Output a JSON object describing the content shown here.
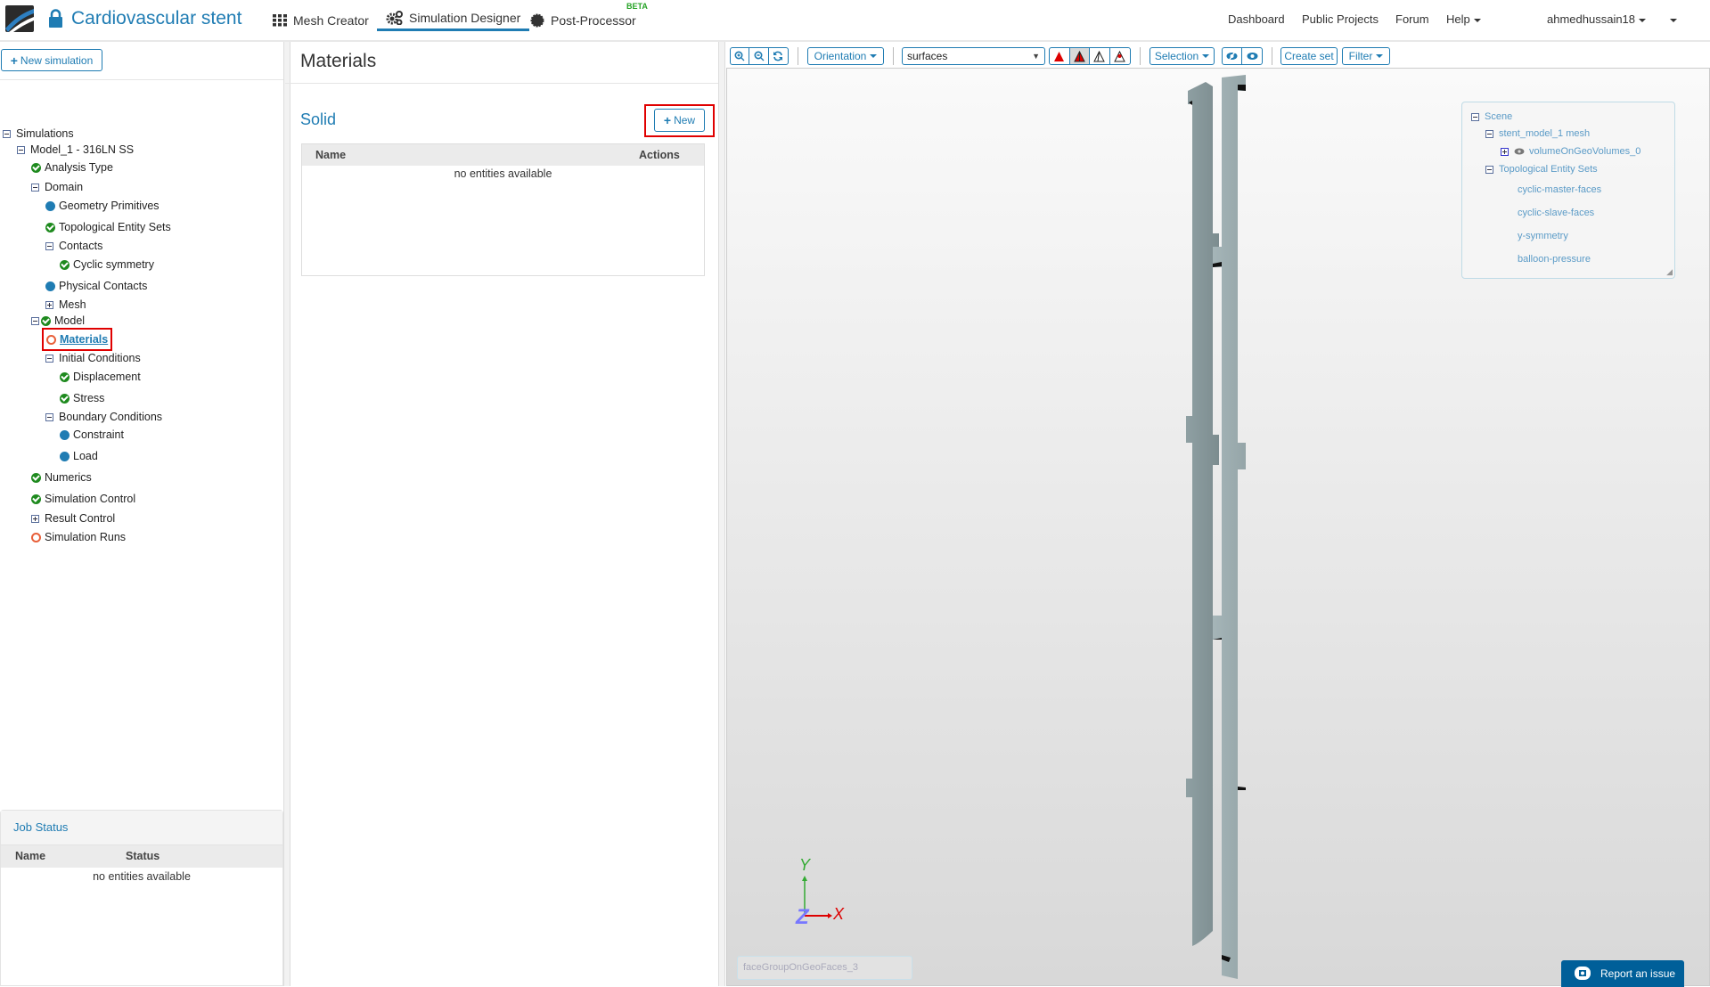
{
  "header": {
    "project_title": "Cardiovascular stent",
    "tabs": [
      {
        "label": "Mesh Creator",
        "icon": "grid-icon"
      },
      {
        "label": "Simulation Designer",
        "icon": "gears-icon",
        "active": true
      },
      {
        "label": "Post-Processor",
        "icon": "gear-icon",
        "badge": "BETA"
      }
    ],
    "right_nav": [
      "Dashboard",
      "Public Projects",
      "Forum",
      "Help"
    ],
    "user": "ahmedhussain18"
  },
  "sidebar": {
    "new_simulation_label": "New simulation",
    "tree": [
      {
        "label": "Simulations",
        "level": 0,
        "icon": "collapse"
      },
      {
        "label": "Model_1 - 316LN SS",
        "level": 1,
        "icon": "collapse"
      },
      {
        "label": "Analysis Type",
        "level": 2,
        "icon": "ok"
      },
      {
        "label": "Domain",
        "level": 2,
        "icon": "collapse"
      },
      {
        "label": "Geometry Primitives",
        "level": 3,
        "icon": "dot"
      },
      {
        "label": "Topological Entity Sets",
        "level": 3,
        "icon": "ok"
      },
      {
        "label": "Contacts",
        "level": 3,
        "icon": "collapse"
      },
      {
        "label": "Cyclic symmetry",
        "level": 4,
        "icon": "ok"
      },
      {
        "label": "Physical Contacts",
        "level": 3,
        "icon": "dot"
      },
      {
        "label": "Mesh",
        "level": 3,
        "icon": "expand"
      },
      {
        "label": "Model",
        "level": 2,
        "icon": "collapse-ok"
      },
      {
        "label": "Materials",
        "level": 3,
        "icon": "ring",
        "selected": true
      },
      {
        "label": "Initial Conditions",
        "level": 3,
        "icon": "collapse"
      },
      {
        "label": "Displacement",
        "level": 4,
        "icon": "ok"
      },
      {
        "label": "Stress",
        "level": 4,
        "icon": "ok"
      },
      {
        "label": "Boundary Conditions",
        "level": 3,
        "icon": "collapse"
      },
      {
        "label": "Constraint",
        "level": 4,
        "icon": "dot"
      },
      {
        "label": "Load",
        "level": 4,
        "icon": "dot"
      },
      {
        "label": "Numerics",
        "level": 2,
        "icon": "ok"
      },
      {
        "label": "Simulation Control",
        "level": 2,
        "icon": "ok"
      },
      {
        "label": "Result Control",
        "level": 2,
        "icon": "expand"
      },
      {
        "label": "Simulation Runs",
        "level": 2,
        "icon": "ring"
      }
    ],
    "job_status": {
      "title": "Job Status",
      "columns": [
        "Name",
        "Status"
      ],
      "empty": "no entities available"
    }
  },
  "main": {
    "title": "Materials",
    "section": "Solid",
    "new_label": "New",
    "columns": [
      "Name",
      "Actions"
    ],
    "empty": "no entities available"
  },
  "viewer": {
    "toolbar": {
      "orientation": "Orientation",
      "render_mode": "surfaces",
      "selection": "Selection",
      "create_set": "Create set",
      "filter": "Filter"
    },
    "scene": {
      "root": "Scene",
      "mesh": "stent_model_1 mesh",
      "volume": "volumeOnGeoVolumes_0",
      "sets_group": "Topological Entity Sets",
      "sets": [
        "cyclic-master-faces",
        "cyclic-slave-faces",
        "y-symmetry",
        "balloon-pressure"
      ]
    },
    "axes": {
      "x": "X",
      "y": "Y",
      "z": "Z"
    },
    "selection_box_value": "faceGroupOnGeoFaces_3",
    "report_issue": "Report an issue"
  },
  "colors": {
    "accent": "#1f7cb3",
    "ok": "#1e8a1e",
    "pending": "#e8603a",
    "highlight": "#e00000"
  }
}
